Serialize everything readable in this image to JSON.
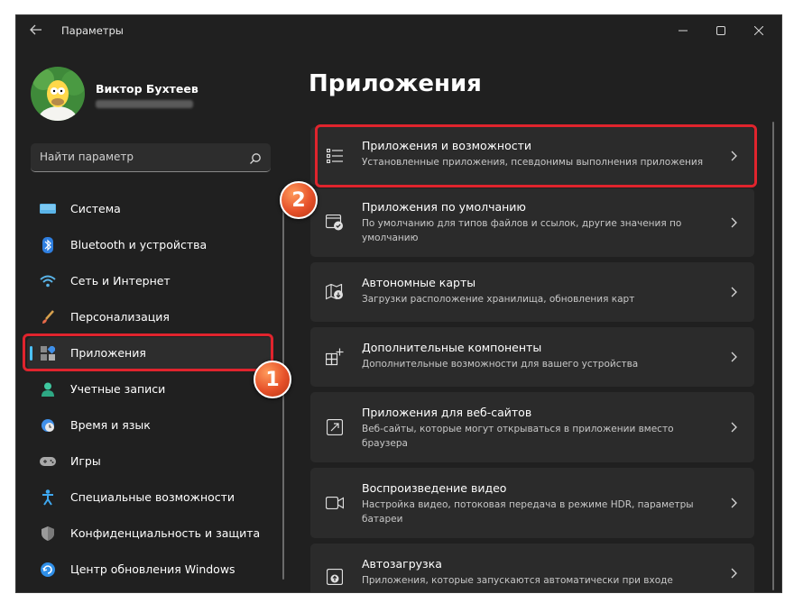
{
  "window": {
    "title": "Параметры",
    "back_icon": "back-arrow-icon",
    "controls": [
      "minimize-icon",
      "maximize-icon",
      "close-icon"
    ]
  },
  "profile": {
    "name": "Виктор Бухтеев",
    "avatar_icon": "user-avatar"
  },
  "search": {
    "placeholder": "Найти параметр",
    "value": "",
    "icon": "search-icon"
  },
  "sidebar": {
    "items": [
      {
        "label": "Система",
        "icon": "system-monitor-icon",
        "active": false
      },
      {
        "label": "Bluetooth и устройства",
        "icon": "bluetooth-icon",
        "active": false
      },
      {
        "label": "Сеть и Интернет",
        "icon": "wifi-icon",
        "active": false
      },
      {
        "label": "Персонализация",
        "icon": "brush-icon",
        "active": false
      },
      {
        "label": "Приложения",
        "icon": "apps-icon",
        "active": true
      },
      {
        "label": "Учетные записи",
        "icon": "person-icon",
        "active": false
      },
      {
        "label": "Время и язык",
        "icon": "globe-clock-icon",
        "active": false
      },
      {
        "label": "Игры",
        "icon": "gamepad-icon",
        "active": false
      },
      {
        "label": "Специальные возможности",
        "icon": "accessibility-icon",
        "active": false
      },
      {
        "label": "Конфиденциальность и защита",
        "icon": "shield-icon",
        "active": false
      },
      {
        "label": "Центр обновления Windows",
        "icon": "windows-update-icon",
        "active": false
      }
    ]
  },
  "main": {
    "title": "Приложения",
    "cards": [
      {
        "title": "Приложения и возможности",
        "desc": "Установленные приложения, псевдонимы выполнения приложения",
        "icon": "apps-list-icon"
      },
      {
        "title": "Приложения по умолчанию",
        "desc": "По умолчанию для типов файлов и ссылок, другие значения по умолчанию",
        "icon": "default-apps-icon"
      },
      {
        "title": "Автономные карты",
        "desc": "Загрузки расположение хранилища, обновления карт",
        "icon": "offline-map-icon"
      },
      {
        "title": "Дополнительные компоненты",
        "desc": "Дополнительные возможности для вашего устройства",
        "icon": "optional-features-icon"
      },
      {
        "title": "Приложения для веб-сайтов",
        "desc": "Веб-сайты, которые могут открываться в приложении вместо браузера",
        "icon": "web-app-icon"
      },
      {
        "title": "Воспроизведение видео",
        "desc": "Настройка видео, потоковая передача в режиме HDR, параметры батареи",
        "icon": "video-camera-icon"
      },
      {
        "title": "Автозагрузка",
        "desc": "Приложения, которые запускаются автоматически при входе",
        "icon": "startup-icon"
      }
    ]
  },
  "annotations": {
    "badge_1": "1",
    "badge_2": "2",
    "highlight_color": "#e0242d"
  },
  "colors": {
    "background": "#202020",
    "card": "#2b2b2b",
    "accent": "#4cc2ff"
  }
}
